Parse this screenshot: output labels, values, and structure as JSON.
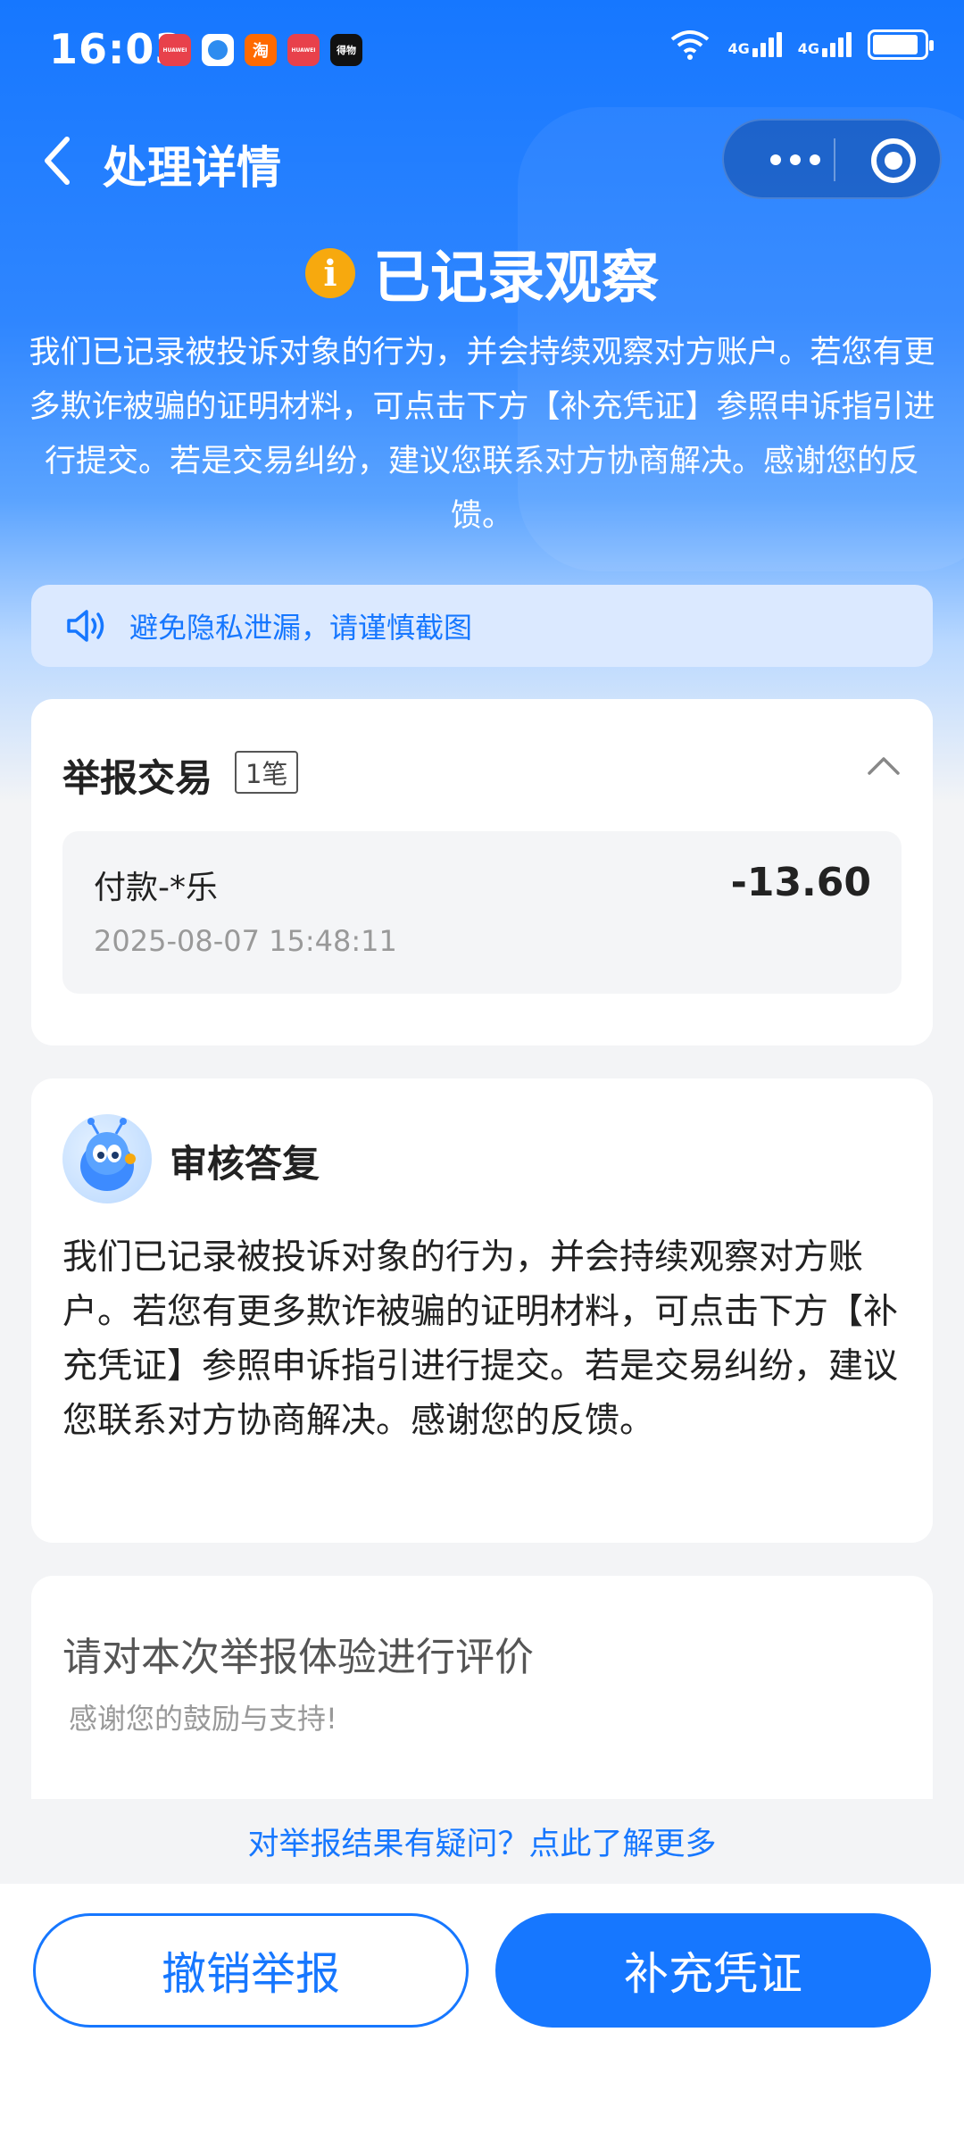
{
  "status_bar": {
    "time": "16:03",
    "notification_apps": [
      {
        "icon": "huawei-appgallery-icon",
        "color": "#e8414b",
        "label": "HUAWEI"
      },
      {
        "icon": "browser-icon",
        "color": "#2d8cf0",
        "label": ""
      },
      {
        "icon": "taobao-icon",
        "color": "#ff6a00",
        "label": "淘"
      },
      {
        "icon": "huawei-store-icon",
        "color": "#e8414b",
        "label": "HUAWEI"
      },
      {
        "icon": "dewu-icon",
        "color": "#111111",
        "label": "得物"
      }
    ],
    "net1": "4G",
    "net2": "4G"
  },
  "nav": {
    "title": "处理详情"
  },
  "status": {
    "title": "已记录观察",
    "icon_char": "i",
    "description": "我们已记录被投诉对象的行为，并会持续观察对方账户。若您有更多欺诈被骗的证明材料，可点击下方【补充凭证】参照申诉指引进行提交。若是交易纠纷，建议您联系对方协商解决。感谢您的反馈。"
  },
  "notice": {
    "text": "避免隐私泄漏，请谨慎截图"
  },
  "report_card": {
    "title": "举报交易",
    "count": "1笔",
    "transaction": {
      "name": "付款-*乐",
      "time": "2025-08-07 15:48:11",
      "amount": "-13.60"
    }
  },
  "reply_card": {
    "title": "审核答复",
    "body": "我们已记录被投诉对象的行为，并会持续观察对方账户。若您有更多欺诈被骗的证明材料，可点击下方【补充凭证】参照申诉指引进行提交。若是交易纠纷，建议您联系对方协商解决。感谢您的反馈。"
  },
  "rating_card": {
    "title": "请对本次举报体验进行评价",
    "subtitle": "感谢您的鼓励与支持!"
  },
  "help_link": "对举报结果有疑问？点此了解更多",
  "buttons": {
    "cancel": "撤销举报",
    "supplement": "补充凭证"
  },
  "colors": {
    "accent": "#1677ff",
    "info": "#f7a90e"
  }
}
